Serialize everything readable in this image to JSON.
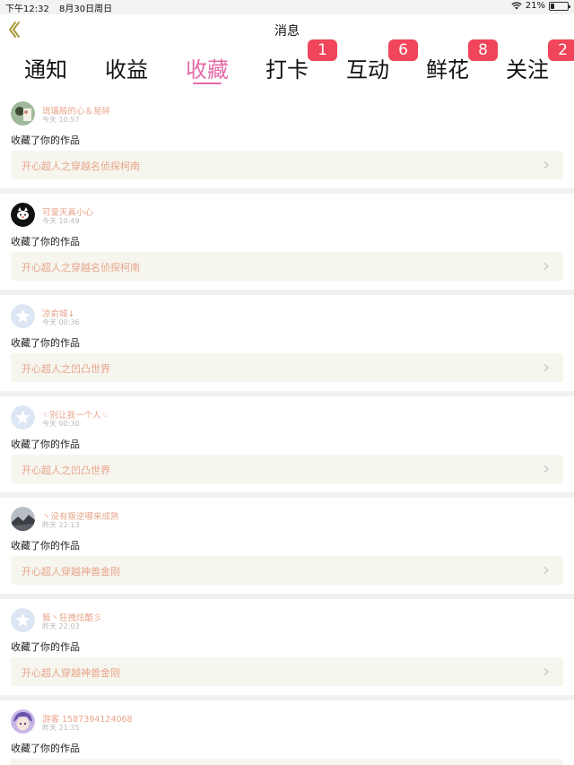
{
  "status": {
    "time": "下午12:32",
    "date": "8月30日周日",
    "battery": "21%",
    "battery_level": 0.21
  },
  "nav": {
    "title": "消息"
  },
  "tabs": [
    {
      "label": "通知",
      "badge": ""
    },
    {
      "label": "收益",
      "badge": ""
    },
    {
      "label": "收藏",
      "badge": "",
      "active": true
    },
    {
      "label": "打卡",
      "badge": "1"
    },
    {
      "label": "互动",
      "badge": "6"
    },
    {
      "label": "鲜花",
      "badge": "8"
    },
    {
      "label": "关注",
      "badge": "2"
    }
  ],
  "items": [
    {
      "user": "琉璃般的心＆易碎",
      "time": "今天 10:57",
      "action": "收藏了你的作品",
      "work": "开心超人之穿越名侦探柯南",
      "avatar": "photo-avatar"
    },
    {
      "user": "可爱天真小心",
      "time": "今天 10:49",
      "action": "收藏了你的作品",
      "work": "开心超人之穿越名侦探柯南",
      "avatar": "cat-avatar"
    },
    {
      "user": "凉俞城↓",
      "time": "今天 00:36",
      "action": "收藏了你的作品",
      "work": "开心超人之凹凸世界",
      "avatar": "default-star-avatar"
    },
    {
      "user": "☜别让我一个人☜",
      "time": "今天 00:30",
      "action": "收藏了你的作品",
      "work": "开心超人之凹凸世界",
      "avatar": "default-star-avatar"
    },
    {
      "user": "丶没有叛逆哪来成熟",
      "time": "昨天 22:13",
      "action": "收藏了你的作品",
      "work": "开心超人穿越神兽金刚",
      "avatar": "landscape-avatar"
    },
    {
      "user": "籖丶狂拽炫酷彡",
      "time": "昨天 22:03",
      "action": "收藏了你的作品",
      "work": "开心超人穿越神兽金刚",
      "avatar": "default-star-avatar"
    },
    {
      "user": "游客 1587394124068",
      "time": "昨天 21:35",
      "action": "收藏了你的作品",
      "work": "",
      "avatar": "anime-avatar"
    }
  ],
  "colors": {
    "accent": "#e56aa8",
    "badge": "#f0455b",
    "username": "#e8a58b",
    "work_bg": "#f6f5ee"
  }
}
